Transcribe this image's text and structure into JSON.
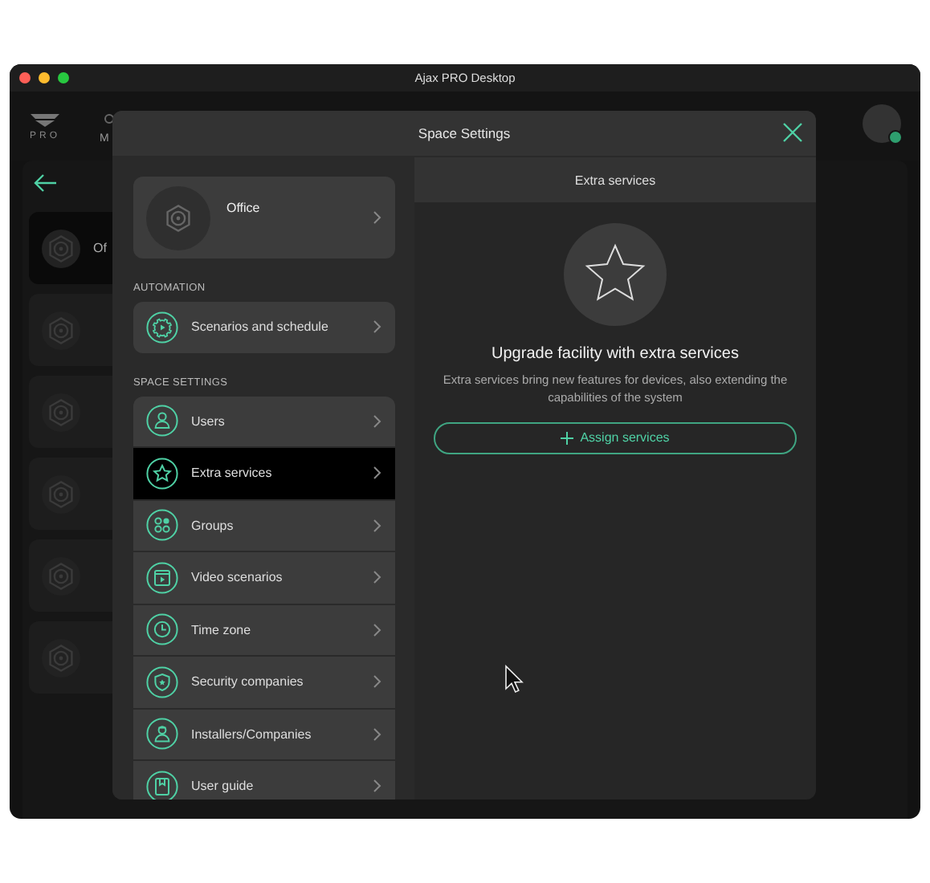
{
  "window": {
    "title": "Ajax PRO Desktop"
  },
  "background": {
    "logo": "PRO",
    "nav_label": "M",
    "first_space": "Of"
  },
  "modal": {
    "title": "Space Settings",
    "space": {
      "name": "Office"
    },
    "sections": [
      {
        "heading": "AUTOMATION",
        "items": [
          {
            "label": "Scenarios and schedule",
            "kind": "gear",
            "selected": false
          }
        ]
      },
      {
        "heading": "SPACE SETTINGS",
        "items": [
          {
            "label": "Users",
            "kind": "user",
            "selected": false
          },
          {
            "label": "Extra services",
            "kind": "star",
            "selected": true
          },
          {
            "label": "Groups",
            "kind": "groups",
            "selected": false
          },
          {
            "label": "Video scenarios",
            "kind": "video",
            "selected": false
          },
          {
            "label": "Time zone",
            "kind": "clock",
            "selected": false
          },
          {
            "label": "Security companies",
            "kind": "shield",
            "selected": false
          },
          {
            "label": "Installers/Companies",
            "kind": "installer",
            "selected": false
          },
          {
            "label": "User guide",
            "kind": "book",
            "selected": false
          }
        ]
      }
    ],
    "detail": {
      "header": "Extra services",
      "title": "Upgrade facility with extra services",
      "description": "Extra services bring new features for devices, also extending the capabilities of the system",
      "button": "Assign services"
    }
  }
}
